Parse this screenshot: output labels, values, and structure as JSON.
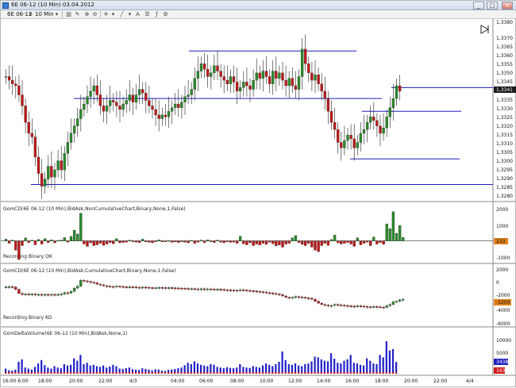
{
  "window": {
    "title": "6E 06-12 (10 Min)  03.04.2012",
    "minimize": "_",
    "maximize": "□",
    "close": "✕"
  },
  "toolbar": {
    "instrument": "6E 06-12",
    "interval": "10 Min"
  },
  "colors": {
    "up": "#2a8a2a",
    "down": "#c01818",
    "line_blue": "#1f1fbd",
    "histogram_blue": "#2020c8",
    "separator": "#8a8a8a",
    "price_marker": "#1a1a1a",
    "orange_marker": "#e08018",
    "red_marker": "#d01818"
  },
  "price_axis": {
    "labels": [
      "1,3380",
      "1,3370",
      "1,3365",
      "1,3360",
      "1,3355",
      "1,3350",
      "1,3345",
      "1,3340",
      "1,3335",
      "1,3330",
      "1,3325",
      "1,3320",
      "1,3315",
      "1,3310",
      "1,3305",
      "1,3300",
      "1,3295",
      "1,3290",
      "1,3285",
      "1,3280"
    ],
    "current_price": "1,3341"
  },
  "time_axis": {
    "labels": [
      "16:00",
      "18:00",
      "20:00",
      "22:00",
      "4/3",
      "04:00",
      "06:00",
      "08:00",
      "10:00",
      "12:00",
      "14:00",
      "16:00",
      "18:00",
      "20:00",
      "22:00",
      "4/4"
    ],
    "start_prefix": "16:00 6:00"
  },
  "panels": [
    {
      "title": "GomCD(6E 06-12 (10 Min),BidAsk,NonCumulativeChart,Binary,None,1,False)",
      "footer": "Recording Binary OK",
      "axis_labels": [
        "2000",
        "1000",
        "-1000"
      ],
      "marker_value": "233"
    },
    {
      "title": "GomCD(6E 06-12 (10 Min),BidAsk,CumulativeChart,Binary,None,1,False)",
      "footer": "Recording Binary KO",
      "axis_labels": [
        "2000",
        "0",
        "-2000",
        "-4000",
        "-6000"
      ],
      "marker_value": "-3200"
    },
    {
      "title": "GomDeltaVolume(6E 06-12 (10 Min),BidAsk,None,1)",
      "footer": "",
      "axis_labels": [
        "10000",
        "5000"
      ],
      "marker_value": "3438",
      "marker_value_2": "193"
    }
  ],
  "chart_data": [
    {
      "type": "candlestick",
      "title": "6E 06-12 (10 Min)",
      "ylim": [
        1.3282,
        1.338
      ],
      "levels": [
        1.3363,
        1.3343,
        1.3337,
        1.333,
        1.3304,
        1.329
      ],
      "closes": [
        1.3349,
        1.3347,
        1.3345,
        1.3344,
        1.3339,
        1.3333,
        1.3324,
        1.3318,
        1.3316,
        1.3305,
        1.3296,
        1.3289,
        1.3293,
        1.33,
        1.3294,
        1.3298,
        1.3303,
        1.3298,
        1.3307,
        1.3313,
        1.3318,
        1.3322,
        1.3326,
        1.3331,
        1.3334,
        1.3338,
        1.3341,
        1.3344,
        1.3339,
        1.3333,
        1.333,
        1.3333,
        1.3336,
        1.3335,
        1.3333,
        1.3331,
        1.3334,
        1.3336,
        1.3339,
        1.3335,
        1.3339,
        1.3342,
        1.334,
        1.3336,
        1.3333,
        1.3331,
        1.3328,
        1.3326,
        1.3328,
        1.3327,
        1.333,
        1.3332,
        1.3334,
        1.3332,
        1.3335,
        1.3338,
        1.3339,
        1.3342,
        1.3348,
        1.3352,
        1.3356,
        1.3353,
        1.3349,
        1.3351,
        1.3355,
        1.3352,
        1.3349,
        1.3347,
        1.3345,
        1.3349,
        1.3346,
        1.3341,
        1.3343,
        1.3346,
        1.3344,
        1.3342,
        1.3347,
        1.3351,
        1.3348,
        1.3352,
        1.3349,
        1.3345,
        1.3352,
        1.3348,
        1.3351,
        1.3347,
        1.3344,
        1.3348,
        1.3344,
        1.3342,
        1.3349,
        1.3364,
        1.3356,
        1.3351,
        1.3347,
        1.335,
        1.3345,
        1.3341,
        1.3337,
        1.333,
        1.3324,
        1.332,
        1.3313,
        1.331,
        1.3314,
        1.3317,
        1.3315,
        1.331,
        1.3313,
        1.3318,
        1.332,
        1.3324,
        1.3327,
        1.3325,
        1.3322,
        1.3318,
        1.3321,
        1.3327,
        1.3332,
        1.3337,
        1.3344,
        1.3341
      ]
    },
    {
      "type": "bar",
      "title": "GomCD NonCumulative",
      "ylim": [
        -1300,
        2400
      ],
      "values": [
        120,
        -150,
        60,
        -600,
        -1200,
        -300,
        200,
        -100,
        50,
        -250,
        100,
        -200,
        150,
        -100,
        80,
        -120,
        40,
        60,
        220,
        -80,
        300,
        700,
        450,
        1800,
        -200,
        -350,
        -120,
        -300,
        -250,
        -150,
        -280,
        -200,
        -100,
        -180,
        150,
        -120,
        -100,
        -80,
        60,
        -50,
        -80,
        -100,
        120,
        -60,
        -90,
        -120,
        -40,
        80,
        -60,
        -40,
        30,
        -90,
        -60,
        -100,
        -50,
        -80,
        -120,
        40,
        -150,
        -80,
        60,
        -110,
        80,
        -40,
        -100,
        60,
        -80,
        -120,
        -50,
        -90,
        -80,
        -150,
        300,
        -180,
        -250,
        -120,
        -300,
        -200,
        -260,
        -150,
        -220,
        -80,
        -180,
        -320,
        -260,
        -400,
        -200,
        -150,
        200,
        350,
        -100,
        -220,
        -300,
        -150,
        -400,
        -600,
        -700,
        -300,
        -150,
        -280,
        100,
        380,
        -120,
        -200,
        -150,
        -100,
        -200,
        -350,
        200,
        -250,
        -150,
        -80,
        -300,
        250,
        -200,
        -100,
        -220,
        1100,
        800,
        1900,
        500,
        1000,
        233
      ]
    },
    {
      "type": "line",
      "title": "GomCD Cumulative",
      "ylim": [
        -6400,
        2800
      ],
      "values": [
        -400,
        -380,
        -450,
        -800,
        -1400,
        -1600,
        -1500,
        -1550,
        -1500,
        -1600,
        -1550,
        -1650,
        -1550,
        -1600,
        -1550,
        -1580,
        -1550,
        -1500,
        -1300,
        -1350,
        -1100,
        -600,
        -300,
        600,
        500,
        400,
        300,
        200,
        0,
        -100,
        -250,
        -300,
        -350,
        -400,
        -300,
        -350,
        -400,
        -450,
        -400,
        -420,
        -470,
        -500,
        -450,
        -480,
        -520,
        -560,
        -540,
        -500,
        -520,
        -540,
        -520,
        -560,
        -580,
        -600,
        -620,
        -650,
        -700,
        -680,
        -720,
        -740,
        -700,
        -760,
        -720,
        -740,
        -780,
        -760,
        -800,
        -850,
        -880,
        -900,
        -920,
        -950,
        -850,
        -900,
        -950,
        -1000,
        -1050,
        -1100,
        -1150,
        -1200,
        -1300,
        -1350,
        -1400,
        -1500,
        -1600,
        -1800,
        -2000,
        -2100,
        -2000,
        -1900,
        -1950,
        -2000,
        -2100,
        -2150,
        -2300,
        -2600,
        -2900,
        -3100,
        -3200,
        -3300,
        -3250,
        -3100,
        -3150,
        -3200,
        -3250,
        -3300,
        -3350,
        -3400,
        -3300,
        -3350,
        -3400,
        -3450,
        -3500,
        -3400,
        -3450,
        -3500,
        -3550,
        -3300,
        -3100,
        -2700,
        -2600,
        -2400,
        -2300
      ]
    },
    {
      "type": "bar",
      "title": "GomDeltaVolume",
      "ylim": [
        0,
        13000
      ],
      "values": [
        1500,
        1000,
        900,
        1200,
        3500,
        4200,
        1800,
        1500,
        1200,
        2000,
        3000,
        4000,
        2500,
        1800,
        1500,
        2200,
        1800,
        1600,
        2800,
        2400,
        2600,
        4500,
        3800,
        5500,
        2800,
        3200,
        2400,
        2600,
        2200,
        2000,
        2400,
        1800,
        2100,
        2600,
        2200,
        1500,
        1400,
        1600,
        1800,
        1300,
        1200,
        1100,
        1600,
        1400,
        1200,
        1000,
        1300,
        1200,
        900,
        800,
        1100,
        1200,
        1400,
        1600,
        1800,
        2500,
        3200,
        2800,
        3600,
        3000,
        2600,
        2400,
        2200,
        2800,
        2600,
        2000,
        1800,
        1600,
        1900,
        1700,
        1600,
        1800,
        2800,
        2000,
        1800,
        1700,
        2200,
        2000,
        1800,
        2400,
        3000,
        2600,
        2200,
        2800,
        3500,
        6500,
        4000,
        2800,
        2600,
        3000,
        2400,
        2200,
        2800,
        3000,
        3600,
        5000,
        4800,
        4200,
        3800,
        3600,
        6000,
        4400,
        3200,
        3000,
        3800,
        4200,
        5500,
        3200,
        3000,
        2600,
        2400,
        4500,
        3800,
        3000,
        2800,
        5500,
        4800,
        9500,
        6800,
        7200,
        3438
      ]
    }
  ]
}
